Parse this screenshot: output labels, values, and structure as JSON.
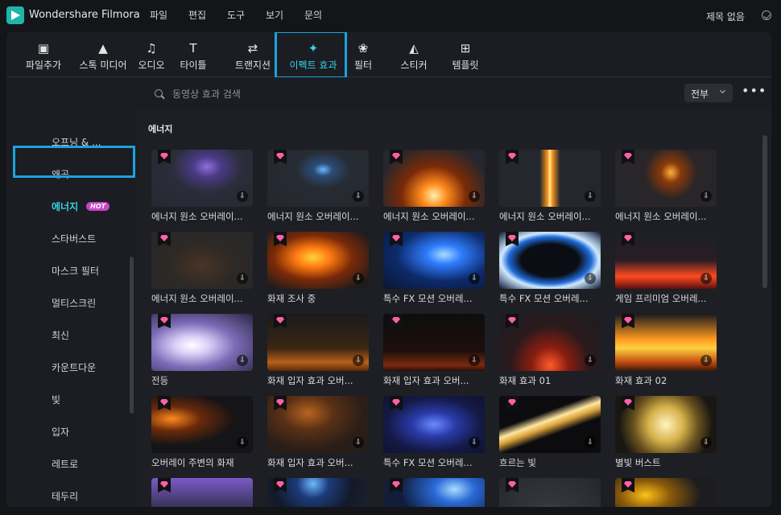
{
  "app": {
    "title": "Wondershare Filmora",
    "untitled": "제목 없음"
  },
  "menu": [
    "파일",
    "편집",
    "도구",
    "보기",
    "문의"
  ],
  "toolbar": [
    {
      "label": "파일추가",
      "icon": "import-icon",
      "glyph": "▣"
    },
    {
      "label": "스톡 미디어",
      "icon": "stock-media-icon",
      "glyph": "▲"
    },
    {
      "label": "오디오",
      "icon": "music-note-icon",
      "glyph": "♫"
    },
    {
      "label": "타이틀",
      "icon": "text-title-icon",
      "glyph": "T"
    },
    {
      "label": "트랜지션",
      "icon": "transition-arrows-icon",
      "glyph": "⇄"
    },
    {
      "label": "이펙트 효과",
      "icon": "effects-star-icon",
      "glyph": "✦"
    },
    {
      "label": "필터",
      "icon": "filter-circles-icon",
      "glyph": "❀"
    },
    {
      "label": "스티커",
      "icon": "sticker-icon",
      "glyph": "◭"
    },
    {
      "label": "템플릿",
      "icon": "template-icon",
      "glyph": "⊞"
    }
  ],
  "sidebar": {
    "items": [
      "오프닝 & ...",
      "왜곡",
      "에너지",
      "스타버스트",
      "마스크 필터",
      "멀티스크린",
      "최신",
      "카운트다운",
      "빛",
      "입자",
      "레트로",
      "테두리"
    ],
    "active_index": 2,
    "hot_badge": "HOT",
    "collapse_glyph": "‹"
  },
  "search": {
    "placeholder": "동영상 효과 검색",
    "filter_label": "전부",
    "more_glyph": "•••"
  },
  "section_title": "에너지",
  "download_glyph": "⇩",
  "items": [
    {
      "title": "에너지 원소 오버레이..."
    },
    {
      "title": "에너지 원소 오버레이..."
    },
    {
      "title": "에너지 원소 오버레이..."
    },
    {
      "title": "에너지 원소 오버레이..."
    },
    {
      "title": "에너지 원소 오버레이..."
    },
    {
      "title": "에너지 원소 오버레이..."
    },
    {
      "title": "화재 조사 중"
    },
    {
      "title": "특수 FX 모션 오버레..."
    },
    {
      "title": "특수 FX 모션 오버레..."
    },
    {
      "title": "게임 프리미엄 오버레..."
    },
    {
      "title": "전등"
    },
    {
      "title": "화재 입자 효과 오버..."
    },
    {
      "title": "화재 입자 효과 오버..."
    },
    {
      "title": "화재 효과 01"
    },
    {
      "title": "화재 효과 02"
    },
    {
      "title": "오버레이 주변의 화재"
    },
    {
      "title": "화재 입자 효과 오버..."
    },
    {
      "title": "특수 FX 모션 오버레..."
    },
    {
      "title": "흐르는 빛"
    },
    {
      "title": "별빛 버스트"
    },
    {
      "title": ""
    },
    {
      "title": ""
    },
    {
      "title": ""
    },
    {
      "title": ""
    },
    {
      "title": ""
    }
  ],
  "colors": {
    "accent": "#36d3e6",
    "highlight_box": "#1aa3e0",
    "hot_badge": "#c646c7",
    "premium_gem": "#ff5fa8"
  }
}
